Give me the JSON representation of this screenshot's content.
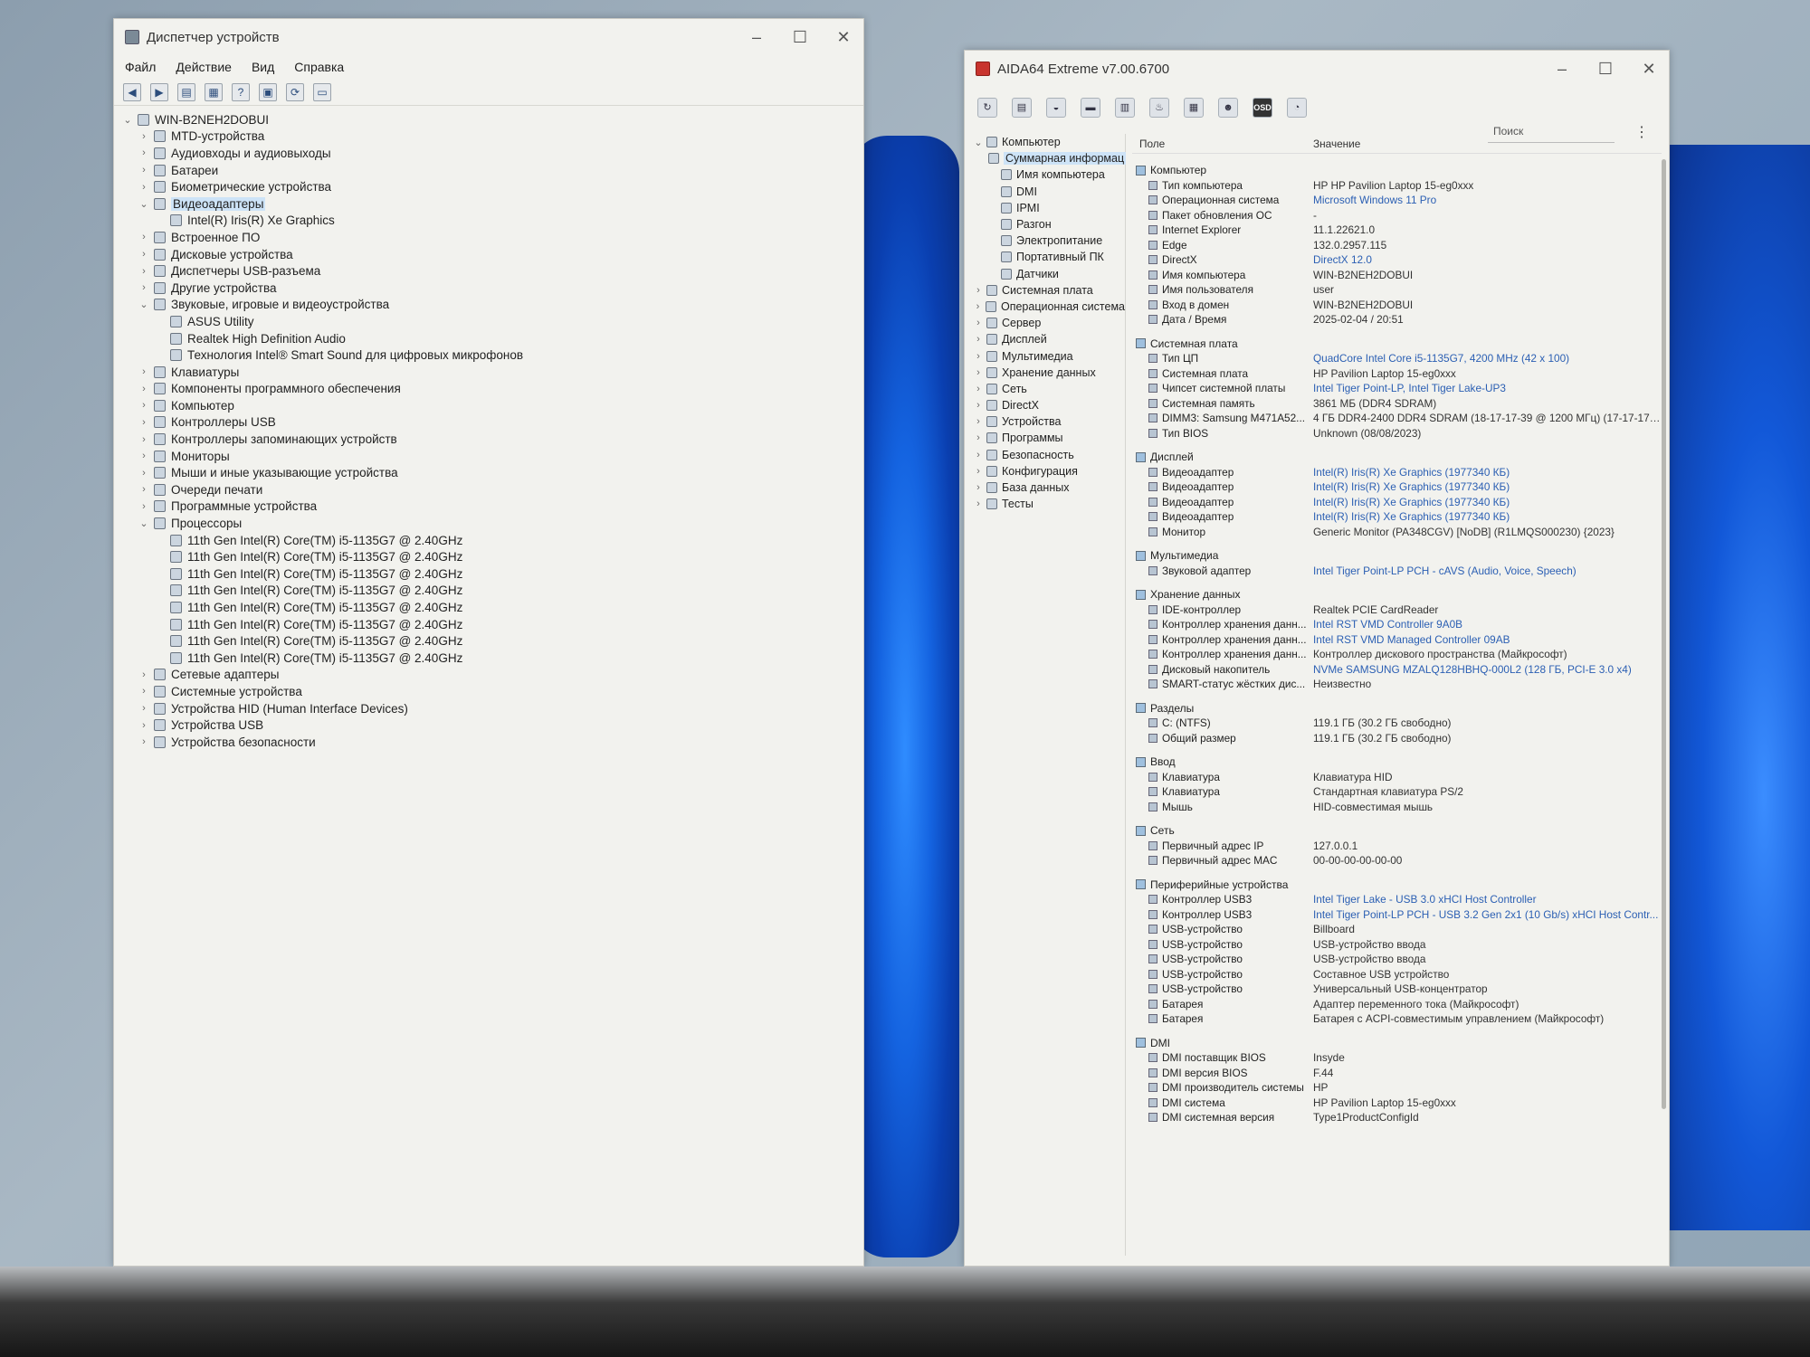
{
  "device_manager": {
    "title": "Диспетчер устройств",
    "menu": [
      "Файл",
      "Действие",
      "Вид",
      "Справка"
    ],
    "tree": [
      {
        "level": 0,
        "expand": "open",
        "label": "WIN-B2NEH2DOBUI",
        "icon": "computer-icon"
      },
      {
        "level": 1,
        "expand": "closed",
        "label": "MTD-устройства",
        "icon": "device-icon"
      },
      {
        "level": 1,
        "expand": "closed",
        "label": "Аудиовходы и аудиовыходы",
        "icon": "speaker-icon"
      },
      {
        "level": 1,
        "expand": "closed",
        "label": "Батареи",
        "icon": "battery-icon"
      },
      {
        "level": 1,
        "expand": "closed",
        "label": "Биометрические устройства",
        "icon": "biometric-icon"
      },
      {
        "level": 1,
        "expand": "open",
        "label": "Видеоадаптеры",
        "icon": "display-adapter-icon",
        "selected": true
      },
      {
        "level": 2,
        "expand": "none",
        "label": "Intel(R) Iris(R) Xe Graphics",
        "icon": "display-adapter-icon"
      },
      {
        "level": 1,
        "expand": "closed",
        "label": "Встроенное ПО",
        "icon": "firmware-icon"
      },
      {
        "level": 1,
        "expand": "closed",
        "label": "Дисковые устройства",
        "icon": "disk-icon"
      },
      {
        "level": 1,
        "expand": "closed",
        "label": "Диспетчеры USB-разъема",
        "icon": "usb-icon"
      },
      {
        "level": 1,
        "expand": "closed",
        "label": "Другие устройства",
        "icon": "unknown-device-icon"
      },
      {
        "level": 1,
        "expand": "open",
        "label": "Звуковые, игровые и видеоустройства",
        "icon": "speaker-icon"
      },
      {
        "level": 2,
        "expand": "none",
        "label": "ASUS Utility",
        "icon": "speaker-icon"
      },
      {
        "level": 2,
        "expand": "none",
        "label": "Realtek High Definition Audio",
        "icon": "speaker-icon"
      },
      {
        "level": 2,
        "expand": "none",
        "label": "Технология Intel® Smart Sound для цифровых микрофонов",
        "icon": "speaker-icon"
      },
      {
        "level": 1,
        "expand": "closed",
        "label": "Клавиатуры",
        "icon": "keyboard-icon"
      },
      {
        "level": 1,
        "expand": "closed",
        "label": "Компоненты программного обеспечения",
        "icon": "software-icon"
      },
      {
        "level": 1,
        "expand": "closed",
        "label": "Компьютер",
        "icon": "computer-icon"
      },
      {
        "level": 1,
        "expand": "closed",
        "label": "Контроллеры USB",
        "icon": "usb-icon"
      },
      {
        "level": 1,
        "expand": "closed",
        "label": "Контроллеры запоминающих устройств",
        "icon": "storage-controller-icon"
      },
      {
        "level": 1,
        "expand": "closed",
        "label": "Мониторы",
        "icon": "monitor-icon"
      },
      {
        "level": 1,
        "expand": "closed",
        "label": "Мыши и иные указывающие устройства",
        "icon": "mouse-icon"
      },
      {
        "level": 1,
        "expand": "closed",
        "label": "Очереди печати",
        "icon": "printer-icon"
      },
      {
        "level": 1,
        "expand": "closed",
        "label": "Программные устройства",
        "icon": "software-icon"
      },
      {
        "level": 1,
        "expand": "open",
        "label": "Процессоры",
        "icon": "cpu-icon"
      },
      {
        "level": 2,
        "expand": "none",
        "label": "11th Gen Intel(R) Core(TM) i5-1135G7 @ 2.40GHz",
        "icon": "cpu-icon"
      },
      {
        "level": 2,
        "expand": "none",
        "label": "11th Gen Intel(R) Core(TM) i5-1135G7 @ 2.40GHz",
        "icon": "cpu-icon"
      },
      {
        "level": 2,
        "expand": "none",
        "label": "11th Gen Intel(R) Core(TM) i5-1135G7 @ 2.40GHz",
        "icon": "cpu-icon"
      },
      {
        "level": 2,
        "expand": "none",
        "label": "11th Gen Intel(R) Core(TM) i5-1135G7 @ 2.40GHz",
        "icon": "cpu-icon"
      },
      {
        "level": 2,
        "expand": "none",
        "label": "11th Gen Intel(R) Core(TM) i5-1135G7 @ 2.40GHz",
        "icon": "cpu-icon"
      },
      {
        "level": 2,
        "expand": "none",
        "label": "11th Gen Intel(R) Core(TM) i5-1135G7 @ 2.40GHz",
        "icon": "cpu-icon"
      },
      {
        "level": 2,
        "expand": "none",
        "label": "11th Gen Intel(R) Core(TM) i5-1135G7 @ 2.40GHz",
        "icon": "cpu-icon"
      },
      {
        "level": 2,
        "expand": "none",
        "label": "11th Gen Intel(R) Core(TM) i5-1135G7 @ 2.40GHz",
        "icon": "cpu-icon"
      },
      {
        "level": 1,
        "expand": "closed",
        "label": "Сетевые адаптеры",
        "icon": "network-icon"
      },
      {
        "level": 1,
        "expand": "closed",
        "label": "Системные устройства",
        "icon": "system-device-icon"
      },
      {
        "level": 1,
        "expand": "closed",
        "label": "Устройства HID (Human Interface Devices)",
        "icon": "hid-icon"
      },
      {
        "level": 1,
        "expand": "closed",
        "label": "Устройства USB",
        "icon": "usb-icon"
      },
      {
        "level": 1,
        "expand": "closed",
        "label": "Устройства безопасности",
        "icon": "security-icon"
      }
    ]
  },
  "aida": {
    "title": "AIDA64 Extreme v7.00.6700",
    "toolbar_osd": "OSD",
    "search_placeholder": "Поиск",
    "col_field": "Поле",
    "col_value": "Значение",
    "nav": [
      {
        "level": 0,
        "expand": "open",
        "label": "Компьютер"
      },
      {
        "level": 1,
        "expand": "none",
        "label": "Суммарная информац",
        "selected": true
      },
      {
        "level": 1,
        "expand": "none",
        "label": "Имя компьютера"
      },
      {
        "level": 1,
        "expand": "none",
        "label": "DMI"
      },
      {
        "level": 1,
        "expand": "none",
        "label": "IPMI"
      },
      {
        "level": 1,
        "expand": "none",
        "label": "Разгон"
      },
      {
        "level": 1,
        "expand": "none",
        "label": "Электропитание"
      },
      {
        "level": 1,
        "expand": "none",
        "label": "Портативный ПК"
      },
      {
        "level": 1,
        "expand": "none",
        "label": "Датчики"
      },
      {
        "level": 0,
        "expand": "closed",
        "label": "Системная плата"
      },
      {
        "level": 0,
        "expand": "closed",
        "label": "Операционная система"
      },
      {
        "level": 0,
        "expand": "closed",
        "label": "Сервер"
      },
      {
        "level": 0,
        "expand": "closed",
        "label": "Дисплей"
      },
      {
        "level": 0,
        "expand": "closed",
        "label": "Мультимедиа"
      },
      {
        "level": 0,
        "expand": "closed",
        "label": "Хранение данных"
      },
      {
        "level": 0,
        "expand": "closed",
        "label": "Сеть"
      },
      {
        "level": 0,
        "expand": "closed",
        "label": "DirectX"
      },
      {
        "level": 0,
        "expand": "closed",
        "label": "Устройства"
      },
      {
        "level": 0,
        "expand": "closed",
        "label": "Программы"
      },
      {
        "level": 0,
        "expand": "closed",
        "label": "Безопасность"
      },
      {
        "level": 0,
        "expand": "closed",
        "label": "Конфигурация"
      },
      {
        "level": 0,
        "expand": "closed",
        "label": "База данных"
      },
      {
        "level": 0,
        "expand": "closed",
        "label": "Тесты"
      }
    ],
    "sections": [
      {
        "title": "Компьютер",
        "rows": [
          [
            "Тип компьютера",
            "HP HP Pavilion Laptop 15-eg0xxx",
            false
          ],
          [
            "Операционная система",
            "Microsoft Windows 11 Pro",
            true
          ],
          [
            "Пакет обновления ОС",
            "-",
            false
          ],
          [
            "Internet Explorer",
            "11.1.22621.0",
            false
          ],
          [
            "Edge",
            "132.0.2957.115",
            false
          ],
          [
            "DirectX",
            "DirectX 12.0",
            true
          ],
          [
            "Имя компьютера",
            "WIN-B2NEH2DOBUI",
            false
          ],
          [
            "Имя пользователя",
            "user",
            false
          ],
          [
            "Вход в домен",
            "WIN-B2NEH2DOBUI",
            false
          ],
          [
            "Дата / Время",
            "2025-02-04 / 20:51",
            false
          ]
        ]
      },
      {
        "title": "Системная плата",
        "rows": [
          [
            "Тип ЦП",
            "QuadCore Intel Core i5-1135G7, 4200 MHz (42 x 100)",
            true
          ],
          [
            "Системная плата",
            "HP Pavilion Laptop 15-eg0xxx",
            false
          ],
          [
            "Чипсет системной платы",
            "Intel Tiger Point-LP, Intel Tiger Lake-UP3",
            true
          ],
          [
            "Системная память",
            "3861 МБ  (DDR4 SDRAM)",
            false
          ],
          [
            "DIMM3: Samsung M471A52...",
            "4 ГБ DDR4-2400 DDR4 SDRAM  (18-17-17-39 @ 1200 МГц)  (17-17-17-...",
            false
          ],
          [
            "Тип BIOS",
            "Unknown (08/08/2023)",
            false
          ]
        ]
      },
      {
        "title": "Дисплей",
        "rows": [
          [
            "Видеоадаптер",
            "Intel(R) Iris(R) Xe Graphics  (1977340 КБ)",
            true
          ],
          [
            "Видеоадаптер",
            "Intel(R) Iris(R) Xe Graphics  (1977340 КБ)",
            true
          ],
          [
            "Видеоадаптер",
            "Intel(R) Iris(R) Xe Graphics  (1977340 КБ)",
            true
          ],
          [
            "Видеоадаптер",
            "Intel(R) Iris(R) Xe Graphics  (1977340 КБ)",
            true
          ],
          [
            "Монитор",
            "Generic Monitor (PA348CGV) [NoDB]  (R1LMQS000230)  {2023}",
            false
          ]
        ]
      },
      {
        "title": "Мультимедиа",
        "rows": [
          [
            "Звуковой адаптер",
            "Intel Tiger Point-LP PCH - cAVS (Audio, Voice, Speech)",
            true
          ]
        ]
      },
      {
        "title": "Хранение данных",
        "rows": [
          [
            "IDE-контроллер",
            "Realtek PCIE CardReader",
            false
          ],
          [
            "Контроллер хранения данн...",
            "Intel RST VMD Controller 9A0B",
            true
          ],
          [
            "Контроллер хранения данн...",
            "Intel RST VMD Managed Controller 09AB",
            true
          ],
          [
            "Контроллер хранения данн...",
            "Контроллер дискового пространства (Майкрософт)",
            false
          ],
          [
            "Дисковый накопитель",
            "NVMe SAMSUNG MZALQ128HBHQ-000L2  (128 ГБ, PCI-E 3.0 x4)",
            true
          ],
          [
            "SMART-статус жёстких дис...",
            "Неизвестно",
            false
          ]
        ]
      },
      {
        "title": "Разделы",
        "rows": [
          [
            "C: (NTFS)",
            "119.1 ГБ (30.2 ГБ свободно)",
            false
          ],
          [
            "Общий размер",
            "119.1 ГБ (30.2 ГБ свободно)",
            false
          ]
        ]
      },
      {
        "title": "Ввод",
        "rows": [
          [
            "Клавиатура",
            "Клавиатура HID",
            false
          ],
          [
            "Клавиатура",
            "Стандартная клавиатура PS/2",
            false
          ],
          [
            "Мышь",
            "HID-совместимая мышь",
            false
          ]
        ]
      },
      {
        "title": "Сеть",
        "rows": [
          [
            "Первичный адрес IP",
            "127.0.0.1",
            false
          ],
          [
            "Первичный адрес MAC",
            "00-00-00-00-00-00",
            false
          ]
        ]
      },
      {
        "title": "Периферийные устройства",
        "rows": [
          [
            "Контроллер USB3",
            "Intel Tiger Lake - USB 3.0 xHCI Host Controller",
            true
          ],
          [
            "Контроллер USB3",
            "Intel Tiger Point-LP PCH - USB 3.2 Gen 2x1 (10 Gb/s) xHCI Host Contr...",
            true
          ],
          [
            "USB-устройство",
            "Billboard",
            false
          ],
          [
            "USB-устройство",
            "USB-устройство ввода",
            false
          ],
          [
            "USB-устройство",
            "USB-устройство ввода",
            false
          ],
          [
            "USB-устройство",
            "Составное USB устройство",
            false
          ],
          [
            "USB-устройство",
            "Универсальный USB-концентратор",
            false
          ],
          [
            "Батарея",
            "Адаптер переменного тока (Майкрософт)",
            false
          ],
          [
            "Батарея",
            "Батарея с ACPI-совместимым управлением (Майкрософт)",
            false
          ]
        ]
      },
      {
        "title": "DMI",
        "rows": [
          [
            "DMI поставщик BIOS",
            "Insyde",
            false
          ],
          [
            "DMI версия BIOS",
            "F.44",
            false
          ],
          [
            "DMI производитель системы",
            "HP",
            false
          ],
          [
            "DMI система",
            "HP Pavilion Laptop 15-eg0xxx",
            false
          ],
          [
            "DMI системная версия",
            "Type1ProductConfigId",
            false
          ]
        ]
      }
    ]
  }
}
